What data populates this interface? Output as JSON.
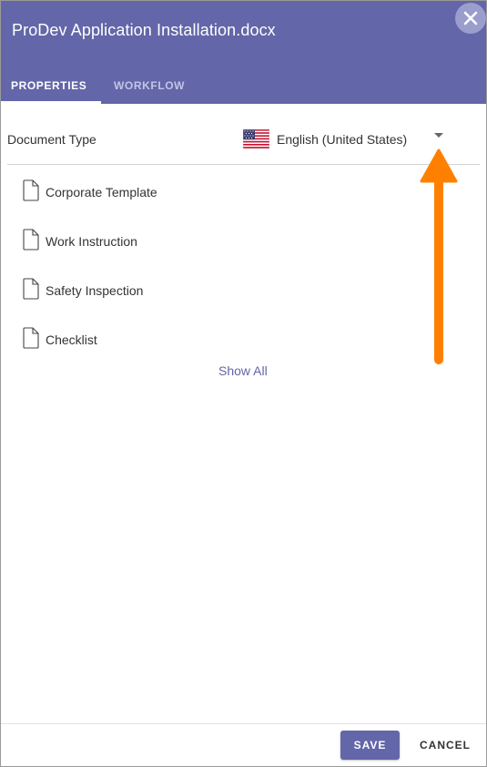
{
  "dialog": {
    "title": "ProDev Application Installation.docx"
  },
  "tabs": [
    {
      "label": "PROPERTIES",
      "active": true
    },
    {
      "label": "WORKFLOW",
      "active": false
    }
  ],
  "document_type": {
    "label": "Document Type",
    "selected_language": "English (United States)",
    "flag_icon": "us-flag-icon"
  },
  "document_list": [
    {
      "label": "Corporate Template",
      "icon": "document-icon"
    },
    {
      "label": "Work Instruction",
      "icon": "document-icon"
    },
    {
      "label": "Safety Inspection",
      "icon": "document-icon"
    },
    {
      "label": "Checklist",
      "icon": "document-icon"
    }
  ],
  "show_all_label": "Show All",
  "footer": {
    "save_label": "SAVE",
    "cancel_label": "CANCEL"
  },
  "colors": {
    "header": "#6366a8",
    "accent": "#6366a8",
    "annotation_arrow": "#ff8000"
  }
}
